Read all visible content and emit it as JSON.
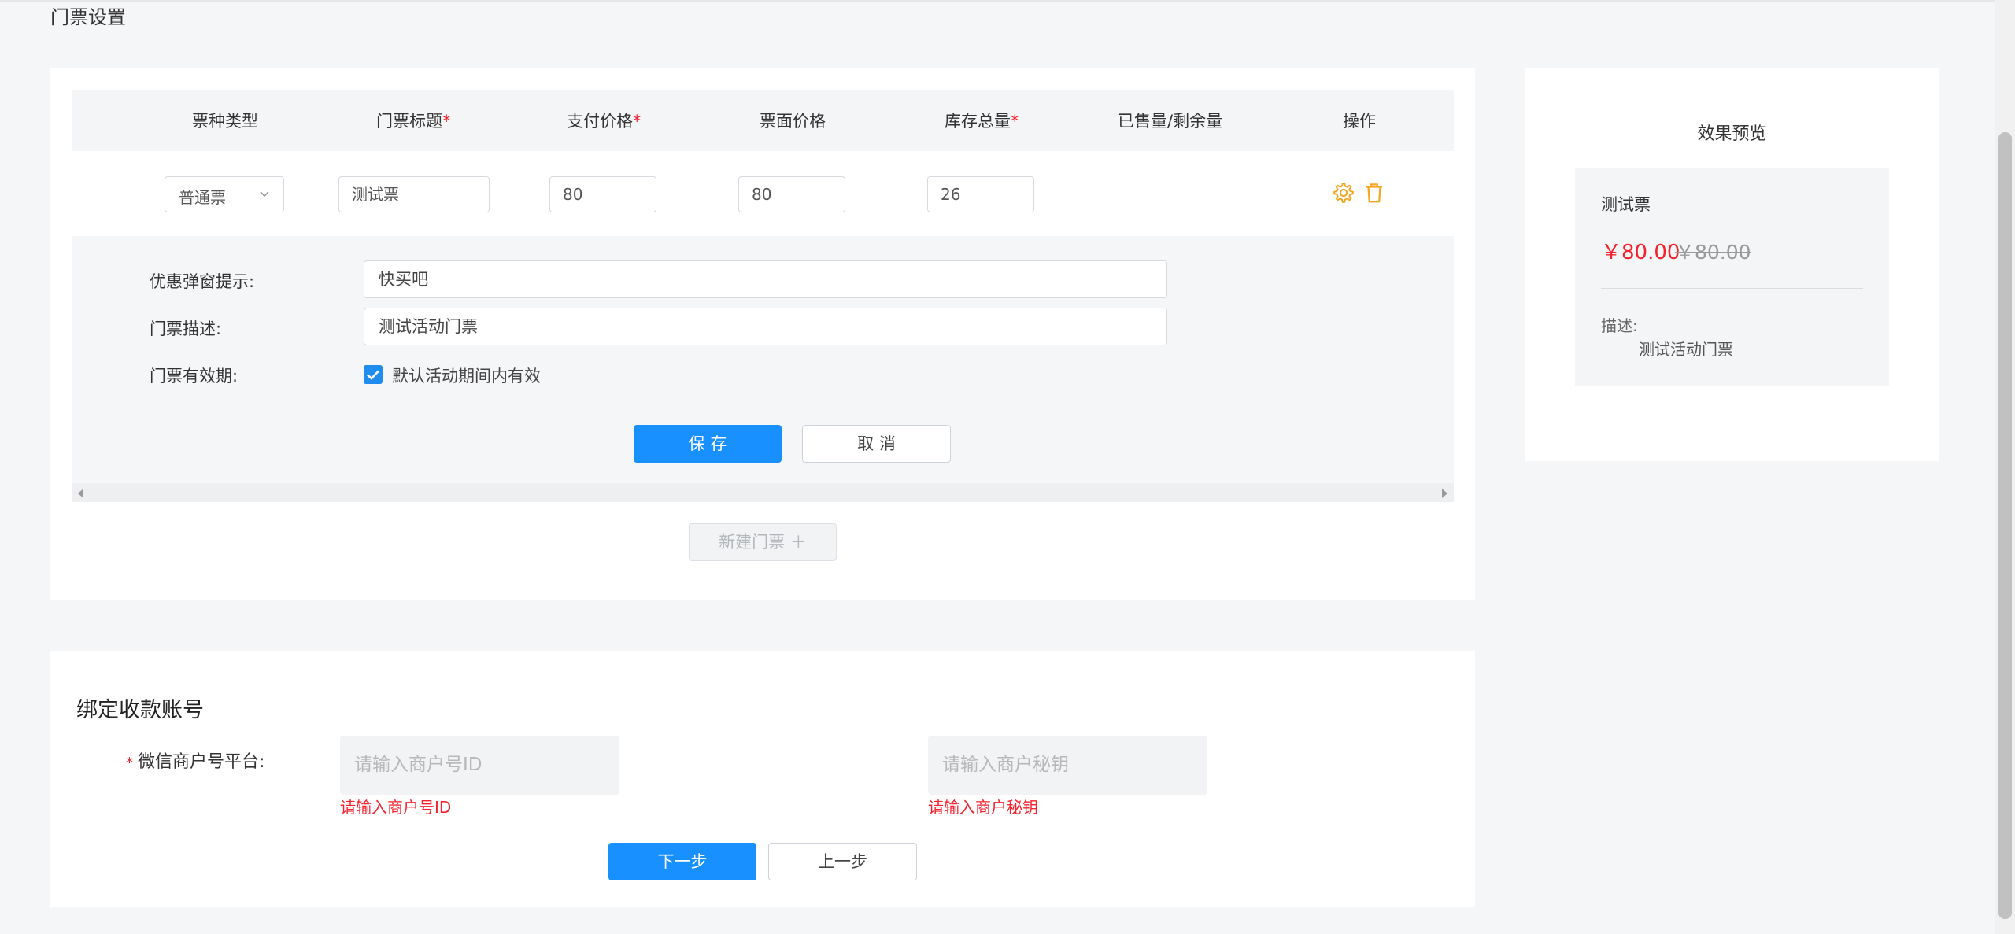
{
  "page": {
    "title": "门票设置"
  },
  "table": {
    "headers": [
      {
        "label": "票种类型",
        "required": ""
      },
      {
        "label": "门票标题",
        "required": "*"
      },
      {
        "label": "支付价格",
        "required": "*"
      },
      {
        "label": "票面价格",
        "required": ""
      },
      {
        "label": "库存总量",
        "required": "*"
      },
      {
        "label": "已售量/剩余量",
        "required": ""
      },
      {
        "label": "操作",
        "required": ""
      }
    ],
    "row": {
      "ticket_type": "普通票",
      "title": "测试票",
      "pay_price": "80",
      "face_price": "80",
      "stock": "26",
      "sold_remaining": ""
    },
    "actions": {
      "settings_icon": "gear-icon",
      "delete_icon": "trash-icon"
    }
  },
  "detail": {
    "promo_label": "优惠弹窗提示:",
    "promo_value": "快买吧",
    "desc_label": "门票描述:",
    "desc_value": "测试活动门票",
    "validity_label": "门票有效期:",
    "validity_checked": true,
    "validity_option": "默认活动期间内有效",
    "save_label": "保 存",
    "cancel_label": "取 消"
  },
  "new_ticket": {
    "label": "新建门票 ＋"
  },
  "preview": {
    "title": "效果预览",
    "ticket_name": "测试票",
    "price": "￥80.00",
    "original_price": "￥80.00",
    "desc_label": "描述:",
    "desc_value": "测试活动门票"
  },
  "account": {
    "title": "绑定收款账号",
    "required_mark": "*",
    "wechat_label": "微信商户号平台:",
    "merchant_id_placeholder": "请输入商户号ID",
    "merchant_id_error": "请输入商户号ID",
    "merchant_key_placeholder": "请输入商户秘钥",
    "merchant_key_error": "请输入商户秘钥",
    "next_label": "下一步",
    "prev_label": "上一步"
  },
  "colors": {
    "primary": "#1890ff",
    "danger": "#f5222d",
    "icon_orange": "#f5a623"
  }
}
